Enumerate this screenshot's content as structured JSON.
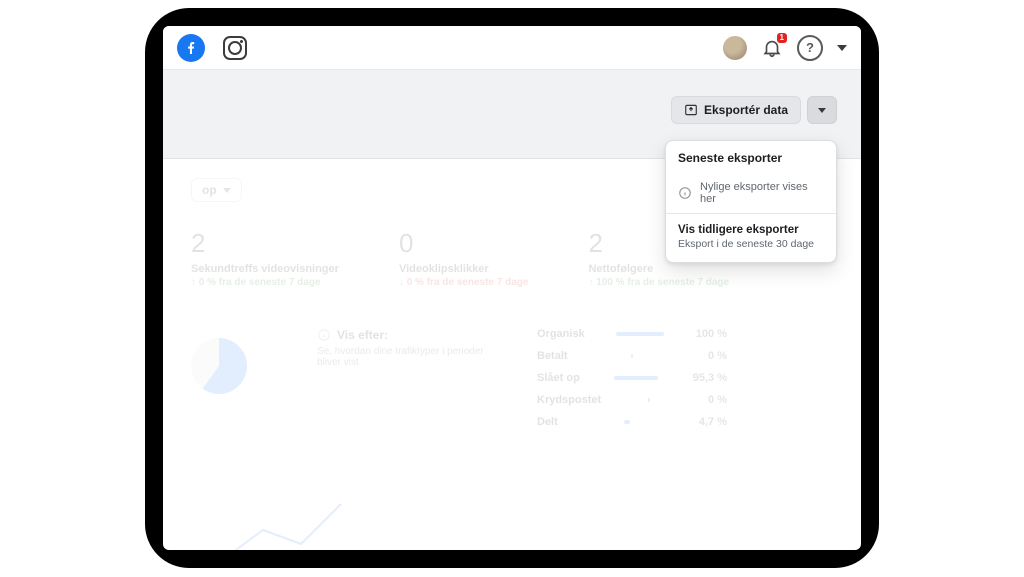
{
  "header": {
    "notification_count": "1"
  },
  "toolbar": {
    "export_label": "Eksportér data"
  },
  "dropdown": {
    "title": "Seneste eksporter",
    "empty_text": "Nylige eksporter vises her",
    "link_title": "Vis tidligere eksporter",
    "link_desc": "Eksport i de seneste 30 dage"
  },
  "page": {
    "selector_label": "op",
    "stats": [
      {
        "value": "2",
        "label": "Sekundtreffs videovisninger",
        "delta": "↑ 0 % fra de seneste 7 dage"
      },
      {
        "value": "0",
        "label": "Videoklipsklikker",
        "delta": "↓ 0 % fra de seneste 7 dage"
      },
      {
        "value": "2",
        "label": "Nettofølgere",
        "delta": "↑ 100 % fra de seneste 7 dage"
      }
    ],
    "info_title": "Vis efter:",
    "info_sub": "Se, hvordan dine trafiktyper i perioder bliver vist",
    "breakdown": [
      {
        "label": "Organisk",
        "width": 48,
        "value": "100 %"
      },
      {
        "label": "Betalt",
        "width": 0,
        "value": "0 %"
      },
      {
        "label": "Slået op",
        "width": 44,
        "value": "95,3 %"
      },
      {
        "label": "Krydspostet",
        "width": 0,
        "value": "0 %"
      },
      {
        "label": "Delt",
        "width": 4,
        "value": "4,7 %"
      }
    ]
  }
}
